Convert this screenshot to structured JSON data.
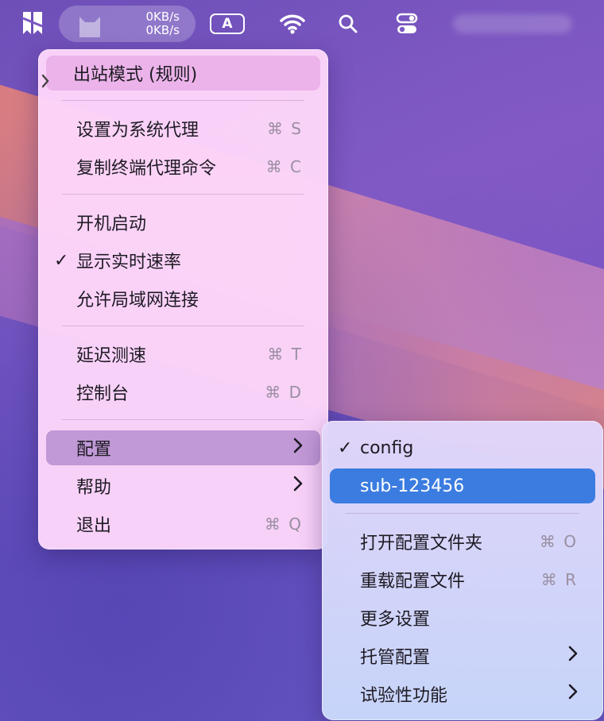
{
  "menubar": {
    "speed_up": "0KB/s",
    "speed_down": "0KB/s",
    "input_source": "A"
  },
  "main_menu": {
    "mode_label": "出站模式 (规则)",
    "set_system_proxy": {
      "label": "设置为系统代理",
      "shortcut": "⌘ S"
    },
    "copy_terminal_cmd": {
      "label": "复制终端代理命令",
      "shortcut": "⌘ C"
    },
    "launch_at_login": {
      "label": "开机启动"
    },
    "show_speed": {
      "label": "显示实时速率",
      "check": "✓"
    },
    "allow_lan": {
      "label": "允许局域网连接"
    },
    "latency_test": {
      "label": "延迟测速",
      "shortcut": "⌘ T"
    },
    "console": {
      "label": "控制台",
      "shortcut": "⌘ D"
    },
    "config": {
      "label": "配置",
      "arrow": "›"
    },
    "help": {
      "label": "帮助",
      "arrow": "›"
    },
    "quit": {
      "label": "退出",
      "shortcut": "⌘ Q"
    }
  },
  "sub_menu": {
    "config_item": {
      "label": "config",
      "check": "✓"
    },
    "sub_item": {
      "label": "sub-123456"
    },
    "open_folder": {
      "label": "打开配置文件夹",
      "shortcut": "⌘ O"
    },
    "reload": {
      "label": "重载配置文件",
      "shortcut": "⌘ R"
    },
    "more_settings": {
      "label": "更多设置"
    },
    "managed": {
      "label": "托管配置",
      "arrow": "›"
    },
    "experimental": {
      "label": "试验性功能",
      "arrow": "›"
    }
  },
  "colors": {
    "highlight_blue": "#3b7ce0",
    "menu_bg": "#fdd6fa"
  }
}
